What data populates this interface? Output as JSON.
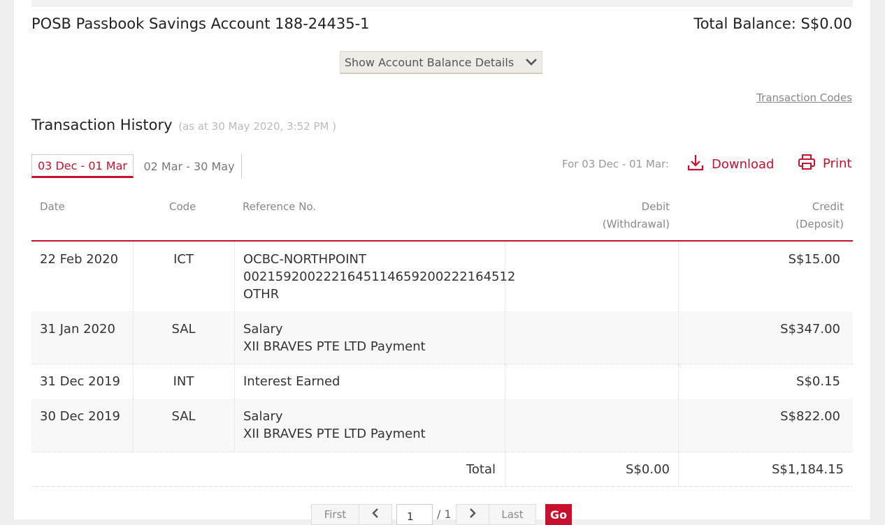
{
  "account": {
    "title": "POSB Passbook Savings Account 188-24435-1",
    "total_balance": "Total Balance: S$0.00",
    "show_details_label": "Show Account Balance Details"
  },
  "transaction_codes_link": "Transaction Codes",
  "history": {
    "title": "Transaction History",
    "as_at": "(as at 30 May 2020, 3:52 PM )",
    "tabs": [
      {
        "label": "03 Dec - 01 Mar",
        "active": true
      },
      {
        "label": "02 Mar - 30 May",
        "active": false
      }
    ],
    "for_label": "For 03 Dec - 01 Mar:",
    "download_label": "Download",
    "print_label": "Print"
  },
  "table": {
    "headers": {
      "date": "Date",
      "code": "Code",
      "reference": "Reference No.",
      "debit": "Debit",
      "debit_sub": "(Withdrawal)",
      "credit": "Credit",
      "credit_sub": "(Deposit)"
    },
    "rows": [
      {
        "date": "22 Feb 2020",
        "code": "ICT",
        "ref": [
          "OCBC-NORTHPOINT",
          "002159200222164511465920022216451​2",
          "OTHR"
        ],
        "debit": "",
        "credit": "S$15.00"
      },
      {
        "date": "31 Jan 2020",
        "code": "SAL",
        "ref": [
          "Salary",
          "XII BRAVES PTE LTD Payment"
        ],
        "debit": "",
        "credit": "S$347.00"
      },
      {
        "date": "31 Dec 2019",
        "code": "INT",
        "ref": [
          "Interest Earned"
        ],
        "debit": "",
        "credit": "S$0.15"
      },
      {
        "date": "30 Dec 2019",
        "code": "SAL",
        "ref": [
          "Salary",
          "XII BRAVES PTE LTD Payment"
        ],
        "debit": "",
        "credit": "S$822.00"
      }
    ],
    "total": {
      "label": "Total",
      "debit": "S$0.00",
      "credit": "S$1,184.15"
    }
  },
  "pagination": {
    "first": "First",
    "last": "Last",
    "current_page": "1",
    "of_pages": "/ 1",
    "go": "Go"
  },
  "colors": {
    "accent": "#c8102e",
    "button_bg": "#efece7"
  }
}
